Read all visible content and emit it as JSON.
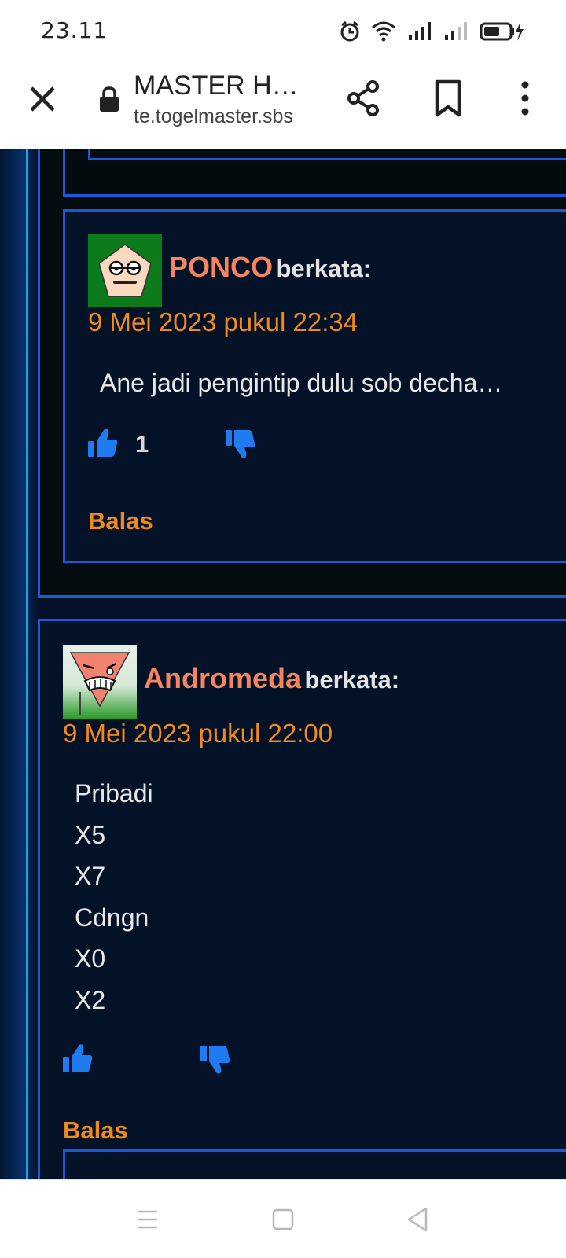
{
  "status_bar": {
    "time": "23.11",
    "icons": [
      "alarm-icon",
      "wifi-icon",
      "signal-icon",
      "signal-weak-icon",
      "battery-charging-icon"
    ]
  },
  "browser": {
    "page_title": "MASTER H…",
    "url": "te.togelmaster.sbs",
    "icons": [
      "close-icon",
      "lock-icon",
      "share-icon",
      "bookmark-icon",
      "more-vert-icon"
    ]
  },
  "comments": [
    {
      "author": "PONCO",
      "says": "berkata:",
      "date": "9 Mei 2023 pukul 22:34",
      "text": "Ane jadi pengintip dulu sob decha…",
      "likes": "1",
      "reply_label": "Balas",
      "avatar": "pentagon-face-avatar"
    },
    {
      "author": "Andromeda",
      "says": "berkata:",
      "date": "9 Mei 2023 pukul 22:00",
      "lines": [
        "Pribadi",
        "X5",
        "X7",
        "Cdngn",
        "X0",
        "X2"
      ],
      "reply_label": "Balas",
      "avatar": "triangle-face-avatar"
    }
  ],
  "colors": {
    "author": "#f5855e",
    "date": "#f28a1a",
    "border": "#1a5ad8",
    "thumb": "#1f7cf0",
    "background": "#041228"
  },
  "nav": {
    "icons": [
      "menu-icon",
      "home-square-icon",
      "back-triangle-icon"
    ]
  }
}
